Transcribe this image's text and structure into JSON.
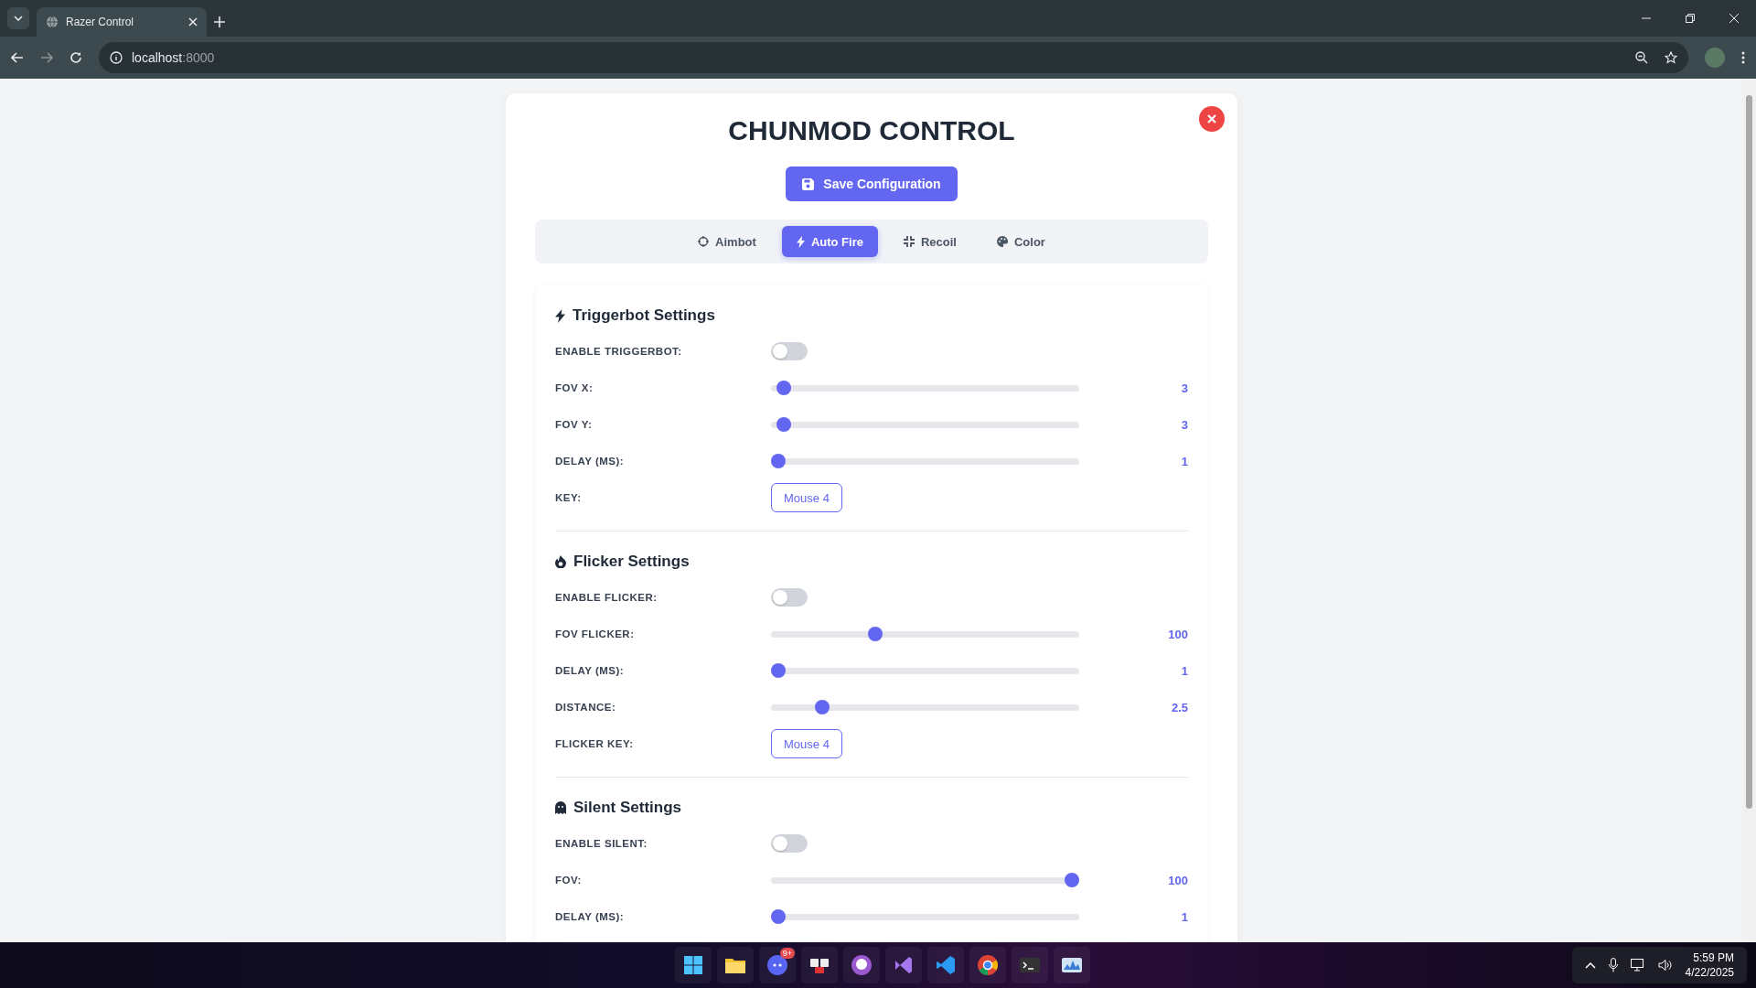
{
  "browser": {
    "tab_title": "Razer Control",
    "url_host": "localhost",
    "url_port": ":8000"
  },
  "panel": {
    "title": "CHUNMOD CONTROL",
    "save_button": "Save Configuration",
    "tabs": [
      {
        "label": "Aimbot",
        "selected": false
      },
      {
        "label": "Auto Fire",
        "selected": true
      },
      {
        "label": "Recoil",
        "selected": false
      },
      {
        "label": "Color",
        "selected": false
      }
    ],
    "sections": [
      {
        "title": "Triggerbot Settings",
        "rows": [
          {
            "kind": "toggle",
            "label": "ENABLE TRIGGERBOT:",
            "on": false
          },
          {
            "kind": "slider",
            "label": "FOV X:",
            "level": 0.02,
            "reading": "3"
          },
          {
            "kind": "slider",
            "label": "FOV Y:",
            "level": 0.02,
            "reading": "3"
          },
          {
            "kind": "slider",
            "label": "DELAY (MS):",
            "level": 0,
            "reading": "1"
          },
          {
            "kind": "key",
            "label": "KEY:",
            "value": "Mouse 4"
          }
        ]
      },
      {
        "title": "Flicker Settings",
        "rows": [
          {
            "kind": "toggle",
            "label": "ENABLE FLICKER:",
            "on": false
          },
          {
            "kind": "slider",
            "label": "FOV FLICKER:",
            "level": 0.33,
            "reading": "100"
          },
          {
            "kind": "slider",
            "label": "DELAY (MS):",
            "level": 0,
            "reading": "1"
          },
          {
            "kind": "slider",
            "label": "DISTANCE:",
            "level": 0.15,
            "reading": "2.5"
          },
          {
            "kind": "key",
            "label": "FLICKER KEY:",
            "value": "Mouse 4"
          }
        ]
      },
      {
        "title": "Silent Settings",
        "rows": [
          {
            "kind": "toggle",
            "label": "ENABLE SILENT:",
            "on": false
          },
          {
            "kind": "slider",
            "label": "FOV:",
            "level": 1,
            "reading": "100"
          },
          {
            "kind": "slider",
            "label": "DELAY (MS):",
            "level": 0,
            "reading": "1"
          }
        ]
      }
    ]
  },
  "taskbar": {
    "discord_badge": "9+",
    "time": "5:59 PM",
    "date": "4/22/2025"
  }
}
